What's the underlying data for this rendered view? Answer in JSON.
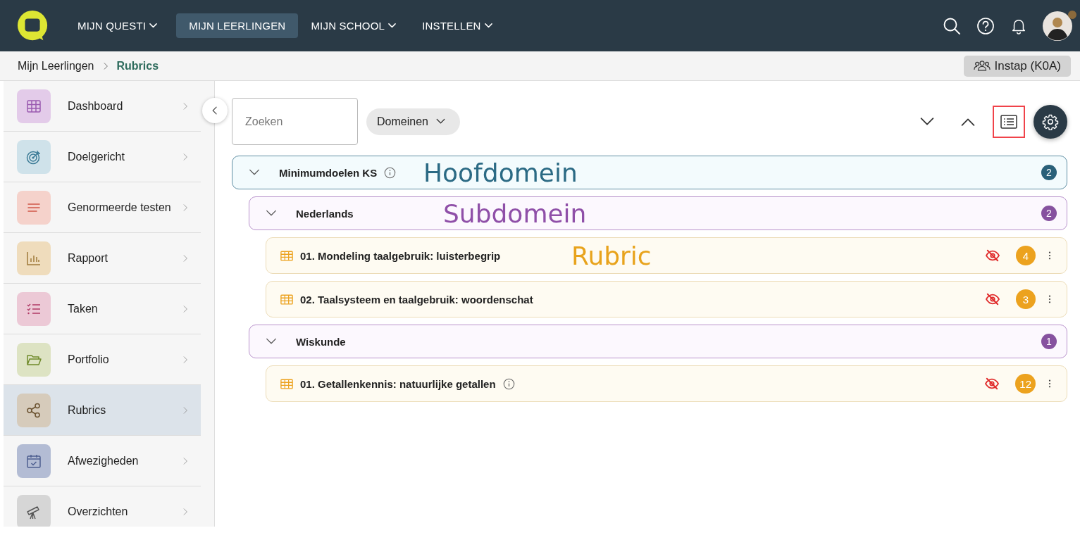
{
  "nav": {
    "items": [
      {
        "label": "MIJN QUESTI",
        "dropdown": true,
        "selected": false
      },
      {
        "label": "MIJN LEERLINGEN",
        "dropdown": false,
        "selected": true
      },
      {
        "label": "MIJN SCHOOL",
        "dropdown": true,
        "selected": false
      },
      {
        "label": "INSTELLEN",
        "dropdown": true,
        "selected": false
      }
    ],
    "notification_dot": true
  },
  "breadcrumb": {
    "items": [
      "Mijn Leerlingen",
      "Rubrics"
    ],
    "class_button": "Instap (K0A)"
  },
  "sidebar": {
    "items": [
      {
        "label": "Dashboard",
        "color": "#e3cbe9",
        "selected": false
      },
      {
        "label": "Doelgericht",
        "color": "#cfe2ea",
        "selected": false
      },
      {
        "label": "Genormeerde testen",
        "color": "#f5d2cb",
        "selected": false
      },
      {
        "label": "Rapport",
        "color": "#efdcbc",
        "selected": false
      },
      {
        "label": "Taken",
        "color": "#ecc9d6",
        "selected": false
      },
      {
        "label": "Portfolio",
        "color": "#dde3c3",
        "selected": false
      },
      {
        "label": "Rubrics",
        "color": "#d6cbbb",
        "selected": true
      },
      {
        "label": "Afwezigheden",
        "color": "#b3bcd4",
        "selected": false
      },
      {
        "label": "Overzichten",
        "color": "#d6d6d6",
        "selected": false
      }
    ]
  },
  "toolbar": {
    "search": {
      "placeholder": "Zoeken"
    },
    "filter": "Domeinen",
    "list_view_highlighted": true
  },
  "tree": [
    {
      "kind": "main",
      "title": "Minimumdoelen KS",
      "info": true,
      "expanded": true,
      "count": "2",
      "annotation": "Hoofdomein",
      "children": [
        {
          "kind": "sub",
          "title": "Nederlands",
          "info": false,
          "expanded": true,
          "count": "2",
          "annotation": "Subdomein",
          "children": [
            {
              "kind": "rubric",
              "title": "01. Mondeling taalgebruik: luisterbegrip",
              "info": false,
              "hidden": true,
              "count": "4",
              "annotation": "Rubric"
            },
            {
              "kind": "rubric",
              "title": "02. Taalsysteem en taalgebruik: woordenschat",
              "info": false,
              "hidden": true,
              "count": "3"
            }
          ]
        },
        {
          "kind": "sub",
          "title": "Wiskunde",
          "info": false,
          "expanded": true,
          "count": "1",
          "children": [
            {
              "kind": "rubric",
              "title": "01. Getallenkennis: natuurlijke getallen",
              "info": true,
              "hidden": true,
              "count": "12"
            }
          ]
        }
      ]
    }
  ]
}
